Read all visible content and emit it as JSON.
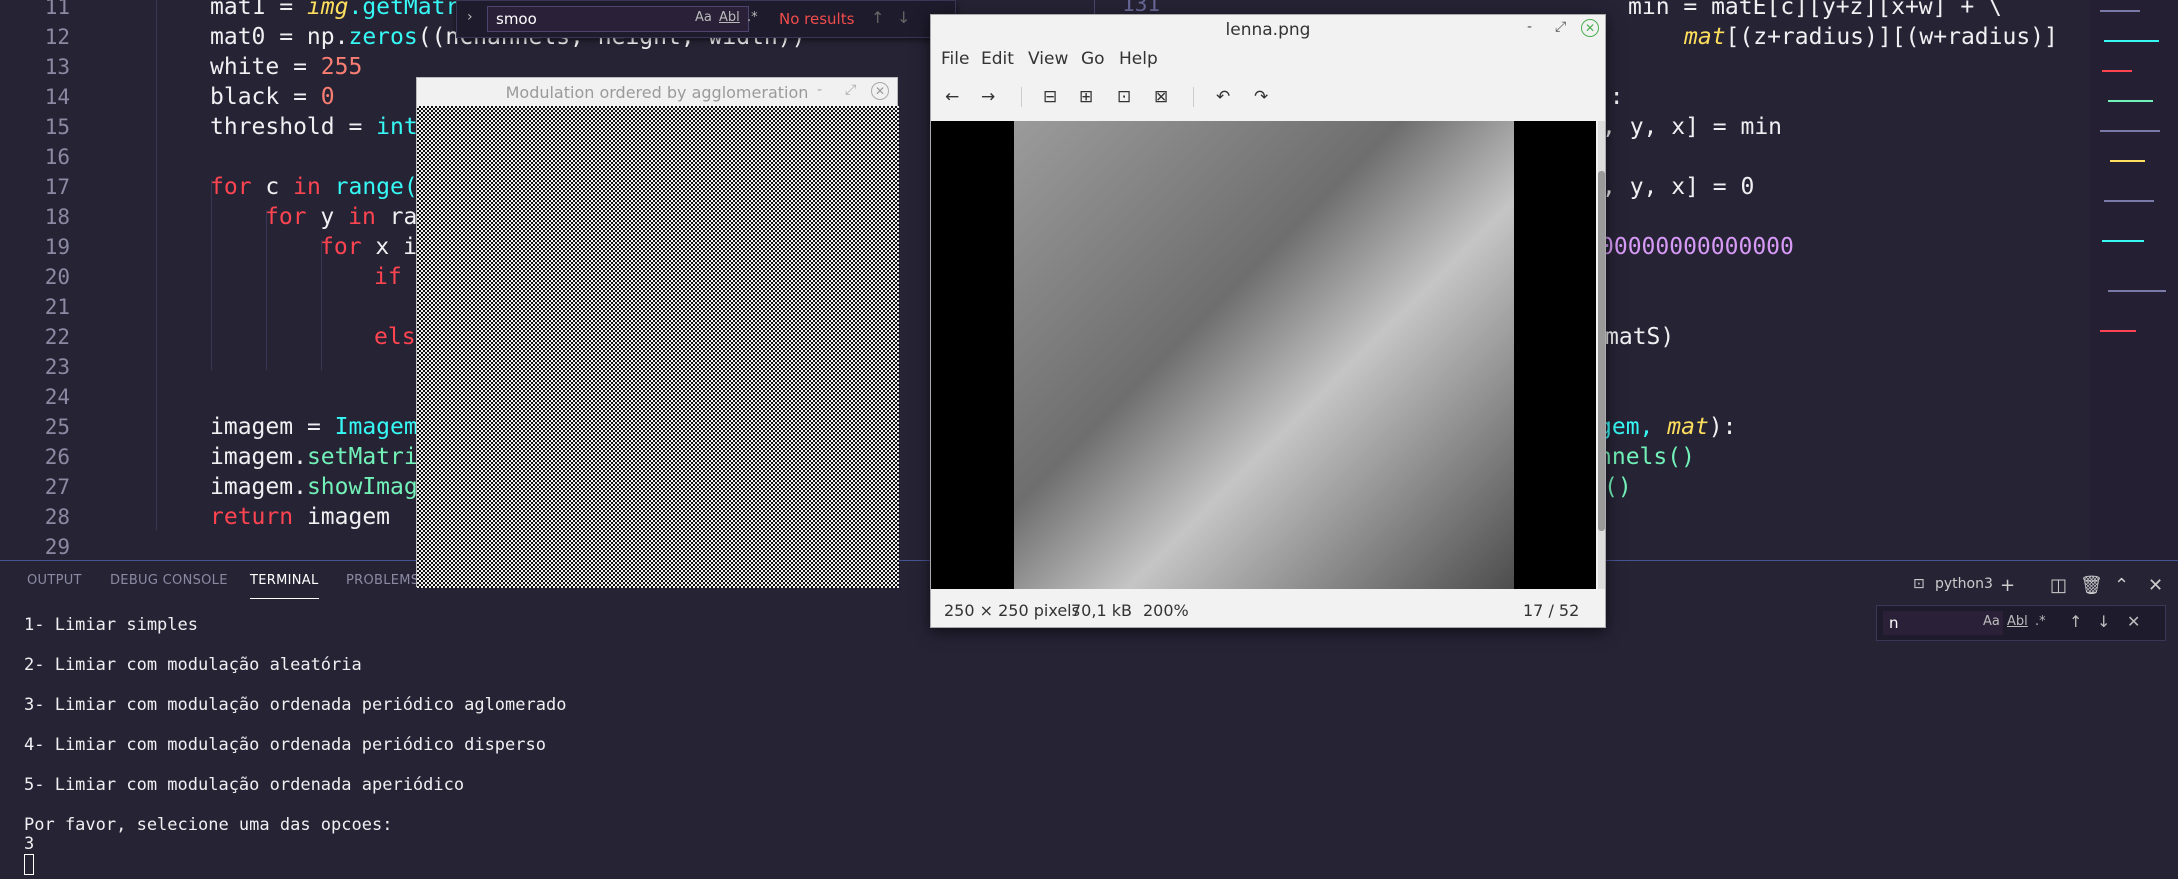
{
  "editor": {
    "line_numbers": [
      "11",
      "12",
      "13",
      "14",
      "15",
      "16",
      "17",
      "18",
      "19",
      "20",
      "21",
      "22",
      "23",
      "24",
      "25",
      "26",
      "27",
      "28",
      "29"
    ],
    "lines": {
      "l11_var": "mat1",
      "l11_rest": " = ",
      "l11_obj": "img",
      "l11_fn": ".getMatr",
      "l12_var": "mat0",
      "l12_rest": " = np.",
      "l12_fn": "zeros",
      "l12_tail": "((nChannels, height, width))",
      "l13_var": "white",
      "l13_rest": " = ",
      "l13_num": "255",
      "l14_var": "black",
      "l14_rest": " = ",
      "l14_num": "0",
      "l15_var": "threshold",
      "l15_rest": " = ",
      "l15_fn": "int",
      "l17_kw": "for",
      "l17_rest": " c ",
      "l17_kw2": "in",
      "l17_fn": " range(",
      "l18_kw": "for",
      "l18_rest": " y ",
      "l18_kw2": "in",
      "l18_tail": " ra",
      "l19_kw": "for",
      "l19_rest": " x i",
      "l20_kw": "if",
      "l22_kw": "els",
      "l25_var": "imagem",
      "l25_rest": " = ",
      "l25_fn": "Imagem",
      "l26_var": "imagem.",
      "l26_fn": "setMatri",
      "l27_var": "imagem.",
      "l27_fn": "showImag",
      "l28_kw": "return",
      "l28_rest": " imagem"
    },
    "right_lines": {
      "r_lineno": "131",
      "r11": "min = matE[c][y+z][x+w] + \\",
      "r12_obj": "mat",
      "r12_rest": "[(z+radius)][(w+radius)]",
      "r14": "0):",
      "r15": ", y, x] = min",
      "r17": ", y, x] = 0",
      "r19": "00000000000000",
      "r22": "matS)",
      "r25_a": "gem, ",
      "r25_obj": "mat",
      "r25_b": "):",
      "r26": "nnels()",
      "r27": "()"
    },
    "find": {
      "value": "smoo",
      "status": "No results",
      "opt_case": "Aa",
      "opt_word": "Abl",
      "opt_regex": ".*"
    }
  },
  "panel": {
    "tabs": [
      "OUTPUT",
      "DEBUG CONSOLE",
      "TERMINAL",
      "PROBLEMS"
    ],
    "active_tab": "TERMINAL",
    "shell": "python3",
    "terminal_lines": [
      "1- Limiar simples",
      "2- Limiar com modulação aleatória",
      "3- Limiar com modulação ordenada periódico aglomerado",
      "4- Limiar com modulação ordenada periódico disperso",
      "5- Limiar com modulação ordenada aperiódico",
      "Por favor, selecione uma das opcoes:",
      "3"
    ],
    "find": {
      "value": "n",
      "opt_case": "Aa",
      "opt_word": "Abl",
      "opt_regex": ".*"
    }
  },
  "modulation_window": {
    "title": "Modulation ordered by agglomeration"
  },
  "viewer": {
    "title": "lenna.png",
    "menu": [
      "File",
      "Edit",
      "View",
      "Go",
      "Help"
    ],
    "status": {
      "dimensions": "250 × 250 pixels",
      "size": "70,1 kB",
      "zoom": "200%",
      "position": "17 / 52"
    }
  },
  "colors": {
    "editor_bg": "#262335",
    "keyword": "#fe4450",
    "function": "#36f9f6",
    "number": "#f97e72",
    "object": "#fede5d",
    "error": "#f14c4c"
  },
  "icons": [
    "chevron-right-icon",
    "back-arrow-icon",
    "forward-arrow-icon",
    "zoom-out-icon",
    "zoom-in-icon",
    "zoom-fit-icon",
    "zoom-original-icon",
    "rotate-left-icon",
    "rotate-right-icon",
    "close-icon",
    "minimize-icon",
    "maximize-icon",
    "plus-icon",
    "split-icon",
    "trash-icon",
    "chevron-up-icon",
    "arrow-up-icon",
    "arrow-down-icon",
    "terminal-icon"
  ]
}
